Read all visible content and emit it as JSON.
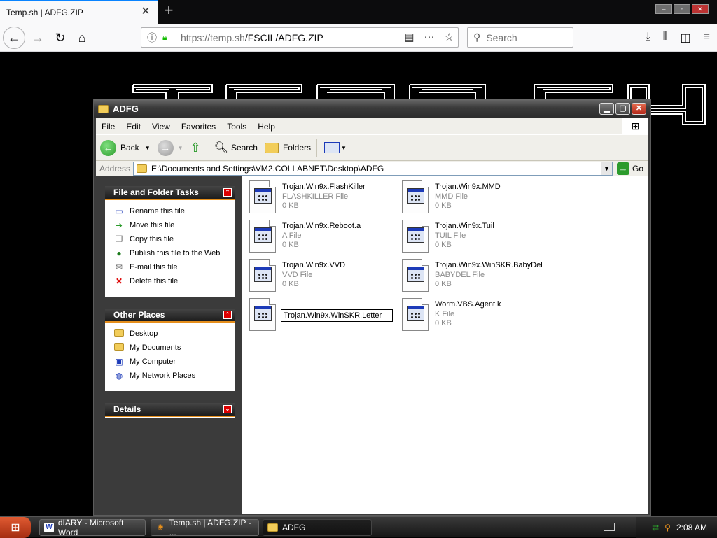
{
  "browser": {
    "tab_title": "Temp.sh | ADFG.ZIP",
    "tab_close": "✕",
    "new_tab": "+",
    "url_domain": "https://temp.sh",
    "url_path": "/FSCIL/ADFG.ZIP",
    "search_placeholder": "Search"
  },
  "explorer": {
    "title": "ADFG",
    "menu": [
      "File",
      "Edit",
      "View",
      "Favorites",
      "Tools",
      "Help"
    ],
    "toolbar": {
      "back": "Back",
      "search": "Search",
      "folders": "Folders"
    },
    "address_label": "Address",
    "address_value": "E:\\Documents and Settings\\VM2.COLLABNET\\Desktop\\ADFG",
    "go_label": "Go",
    "file_tasks": {
      "title": "File and Folder Tasks",
      "items": [
        "Rename this file",
        "Move this file",
        "Copy this file",
        "Publish this file to the Web",
        "E-mail this file",
        "Delete this file"
      ]
    },
    "other_places": {
      "title": "Other Places",
      "items": [
        "Desktop",
        "My Documents",
        "My Computer",
        "My Network Places"
      ]
    },
    "details": {
      "title": "Details"
    },
    "files": [
      {
        "name": "Trojan.Win9x.FlashKiller",
        "type": "FLASHKILLER File",
        "size": "0 KB"
      },
      {
        "name": "Trojan.Win9x.MMD",
        "type": "MMD File",
        "size": "0 KB"
      },
      {
        "name": "Trojan.Win9x.Reboot.a",
        "type": "A File",
        "size": "0 KB"
      },
      {
        "name": "Trojan.Win9x.Tuil",
        "type": "TUIL File",
        "size": "0 KB"
      },
      {
        "name": "Trojan.Win9x.VVD",
        "type": "VVD File",
        "size": "0 KB"
      },
      {
        "name": "Trojan.Win9x.WinSKR.BabyDel",
        "type": "BABYDEL File",
        "size": "0 KB"
      },
      {
        "name": "Trojan.Win9x.WinSKR.Letter",
        "type": "",
        "size": ""
      },
      {
        "name": "Worm.VBS.Agent.k",
        "type": "K File",
        "size": "0 KB"
      }
    ]
  },
  "taskbar": {
    "buttons": [
      "dIARY - Microsoft Word",
      "Temp.sh | ADFG.ZIP - ...",
      "ADFG"
    ],
    "clock": "2:08 AM"
  },
  "colors": {
    "accent_orange": "#e58e1b",
    "firefox_blue": "#0a84ff",
    "lock_green": "#12bc00"
  }
}
